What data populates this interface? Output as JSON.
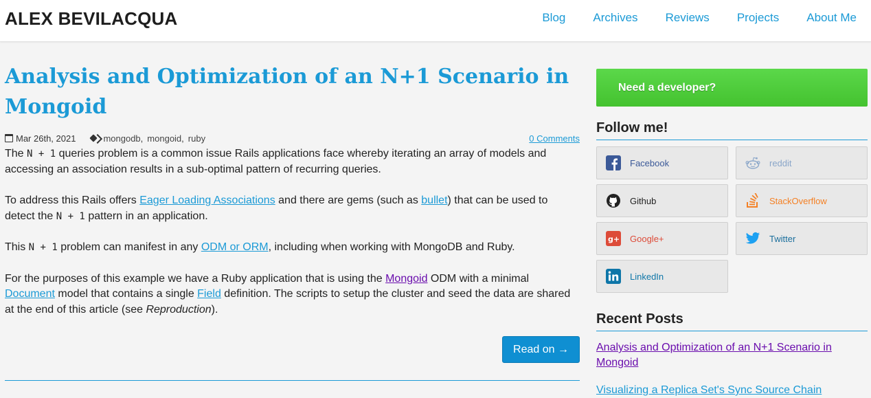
{
  "site": {
    "title": "ALEX BEVILACQUA"
  },
  "nav": {
    "items": [
      "Blog",
      "Archives",
      "Reviews",
      "Projects",
      "About Me"
    ]
  },
  "post": {
    "title": "Analysis and Optimization of an N+1 Scenario in Mongoid",
    "date": "Mar 26th, 2021",
    "tags": [
      "mongodb",
      "mongoid",
      "ruby"
    ],
    "comments": "0 Comments",
    "p1": {
      "a": "The ",
      "code": "N + 1",
      "b": " queries problem is a common issue Rails applications face whereby iterating an array of models and accessing an association results in a sub-optimal pattern of recurring queries."
    },
    "p2": {
      "a": "To address this Rails offers ",
      "link1": "Eager Loading Associations",
      "b": " and there are gems (such as ",
      "link2": "bullet",
      "c": ") that can be used to detect the ",
      "code": "N + 1",
      "d": " pattern in an application."
    },
    "p3": {
      "a": "This ",
      "code": "N + 1",
      "b": " problem can manifest in any ",
      "link": "ODM or ORM",
      "c": ", including when working with MongoDB and Ruby."
    },
    "p4": {
      "a": "For the purposes of this example we have a Ruby application that is using the ",
      "link1": "Mongoid",
      "b": " ODM with a minimal ",
      "link2": "Document",
      "c": " model that contains a single ",
      "link3": "Field",
      "d": " definition. The scripts to setup the cluster and seed the data are shared at the end of this article (see ",
      "em": "Reproduction",
      "e": ")."
    },
    "read_on": "Read on →"
  },
  "sidebar": {
    "cta": "Need a developer?",
    "follow_heading": "Follow me!",
    "social": [
      {
        "label": "Facebook",
        "icon": "facebook-icon",
        "color": "#3b5998"
      },
      {
        "label": "reddit",
        "icon": "reddit-icon",
        "color": "#8aa6c9"
      },
      {
        "label": "Github",
        "icon": "github-icon",
        "color": "#222222"
      },
      {
        "label": "StackOverflow",
        "icon": "stackoverflow-icon",
        "color": "#f48024"
      },
      {
        "label": "Google+",
        "icon": "google-plus-icon",
        "color": "#dd4b39"
      },
      {
        "label": "Twitter",
        "icon": "twitter-icon",
        "color": "#1da1f2"
      },
      {
        "label": "LinkedIn",
        "icon": "linkedin-icon",
        "color": "#0e76a8"
      }
    ],
    "recent_heading": "Recent Posts",
    "recent": [
      "Analysis and Optimization of an N+1 Scenario in Mongoid",
      "Visualizing a Replica Set's Sync Source Chain"
    ]
  }
}
